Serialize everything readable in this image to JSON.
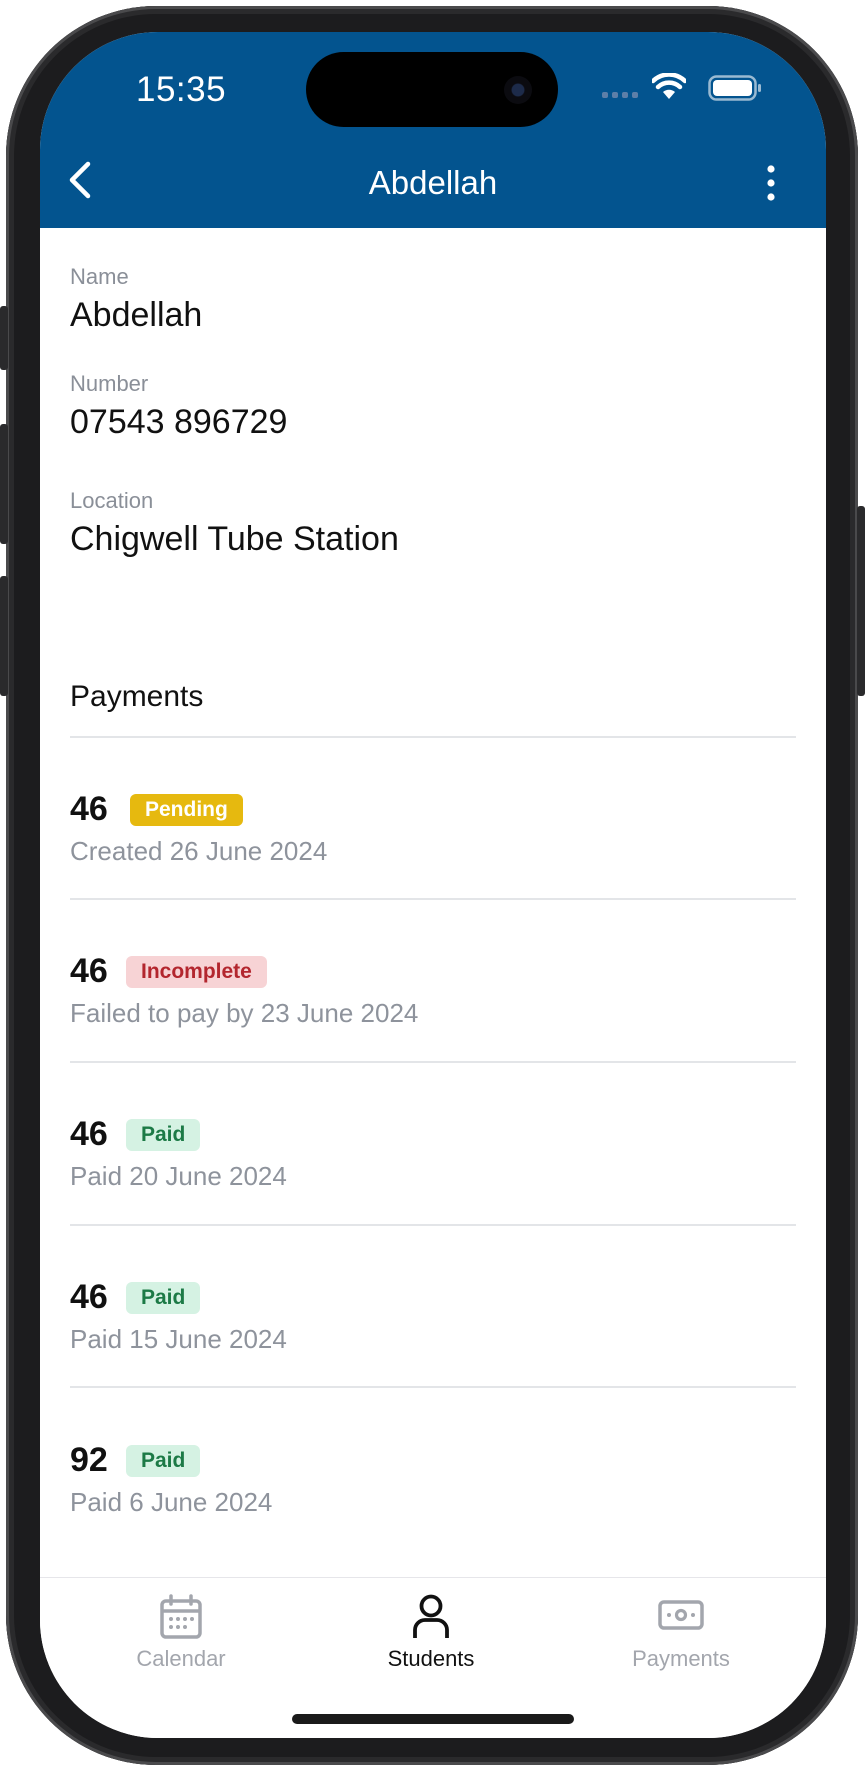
{
  "status_bar": {
    "time": "15:35"
  },
  "header": {
    "title": "Abdellah"
  },
  "student": {
    "name_label": "Name",
    "name_value": "Abdellah",
    "number_label": "Number",
    "number_value": "07543 896729",
    "location_label": "Location",
    "location_value": "Chigwell Tube Station"
  },
  "payments_section": {
    "title": "Payments",
    "items": [
      {
        "amount": "46",
        "status": "Pending",
        "detail": "Created 26 June 2024"
      },
      {
        "amount": "46",
        "status": "Incomplete",
        "detail": "Failed to pay by 23 June 2024"
      },
      {
        "amount": "46",
        "status": "Paid",
        "detail": "Paid 20 June 2024"
      },
      {
        "amount": "46",
        "status": "Paid",
        "detail": "Paid 15 June 2024"
      },
      {
        "amount": "92",
        "status": "Paid",
        "detail": "Paid 6 June 2024"
      }
    ]
  },
  "tabbar": {
    "tabs": [
      {
        "label": "Calendar",
        "icon": "calendar-icon",
        "active": false
      },
      {
        "label": "Students",
        "icon": "person-icon",
        "active": true
      },
      {
        "label": "Payments",
        "icon": "cash-icon",
        "active": false
      }
    ]
  },
  "colors": {
    "header_bg": "#03548f",
    "pending": "#e6b90f",
    "incomplete_bg": "#f7d3d5",
    "incomplete_text": "#b3262e",
    "paid_bg": "#d5f2e3",
    "paid_text": "#1c7a46",
    "tab_active": "#111111",
    "tab_inactive": "#a3a6ad"
  }
}
